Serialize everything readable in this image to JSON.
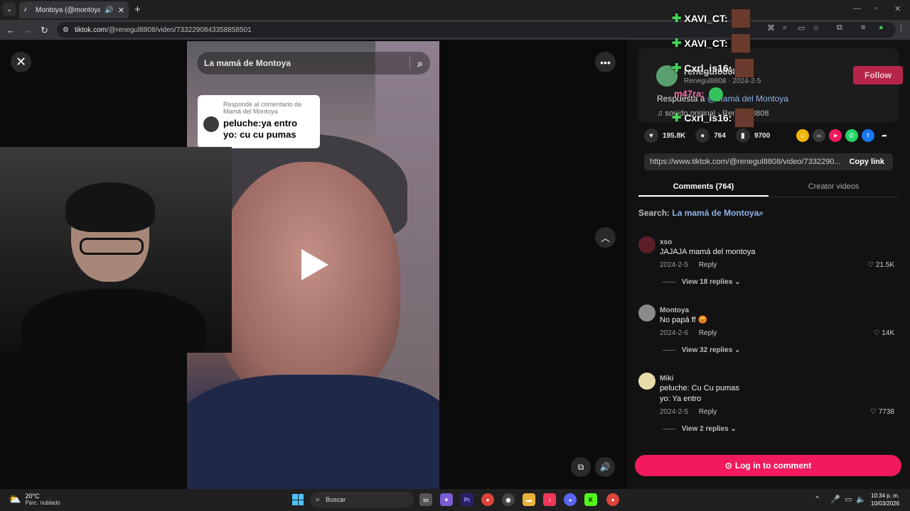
{
  "browser": {
    "tab_title": "Montoya (@montoyatrrr) |",
    "url_host": "tiktok.com",
    "url_path": "/@renegul8808/video/7332290843358858501"
  },
  "video": {
    "search_text": "La mamá de Montoya",
    "reply_card": {
      "header": "Responde al comentario de Mamá del Montoya",
      "body_line1": "peluche:ya entro",
      "body_line2": "yo: cu cu pumas"
    }
  },
  "author": {
    "name": "renegul8808",
    "sub": "Renegul8808 · 2024-2-5",
    "follow_label": "Follow",
    "desc_prefix": "Respuesta a",
    "desc_mention": "@Mamá del Montoya",
    "music": "sonido original - Renegul8808"
  },
  "stats": {
    "likes": "195.8K",
    "comments": "764",
    "saves": "9700"
  },
  "share_icons": [
    "embed-icon",
    "code-icon",
    "send-icon",
    "whatsapp-icon",
    "facebook-icon",
    "share-arrow-icon"
  ],
  "link": {
    "url": "https://www.tiktok.com/@renegul8808/video/7332290...",
    "copy_label": "Copy link"
  },
  "tabs": {
    "comments": "Comments (764)",
    "creator": "Creator videos"
  },
  "search": {
    "prefix": "Search:",
    "query": "La mamá de Montoya"
  },
  "comments": [
    {
      "user": "xso",
      "text": "JAJAJA mamá del montoya",
      "date": "2024-2-5",
      "reply": "Reply",
      "likes": "21.5K",
      "replies": "View 18 replies"
    },
    {
      "user": "Montoya",
      "text": "No papá ff 😡",
      "date": "2024-2-6",
      "reply": "Reply",
      "likes": "14K",
      "replies": "View 32 replies"
    },
    {
      "user": "Miki",
      "text": "peluche: Cu Cu pumas\nyo: Ya entro",
      "date": "2024-2-5",
      "reply": "Reply",
      "likes": "7738",
      "replies": "View 2 replies"
    }
  ],
  "login_label": "Log in to comment",
  "chat_overlay": {
    "lines": [
      "XAVI_CT:",
      "XAVI_CT:",
      "Cxrl_is16:",
      "Cxrl_is16:"
    ],
    "mid_user": "m47ra:"
  },
  "taskbar": {
    "temp": "20°C",
    "condition": "Parc. nublado",
    "search_label": "Buscar",
    "time": "10:34 p. m.",
    "date": "10/03/2026"
  }
}
